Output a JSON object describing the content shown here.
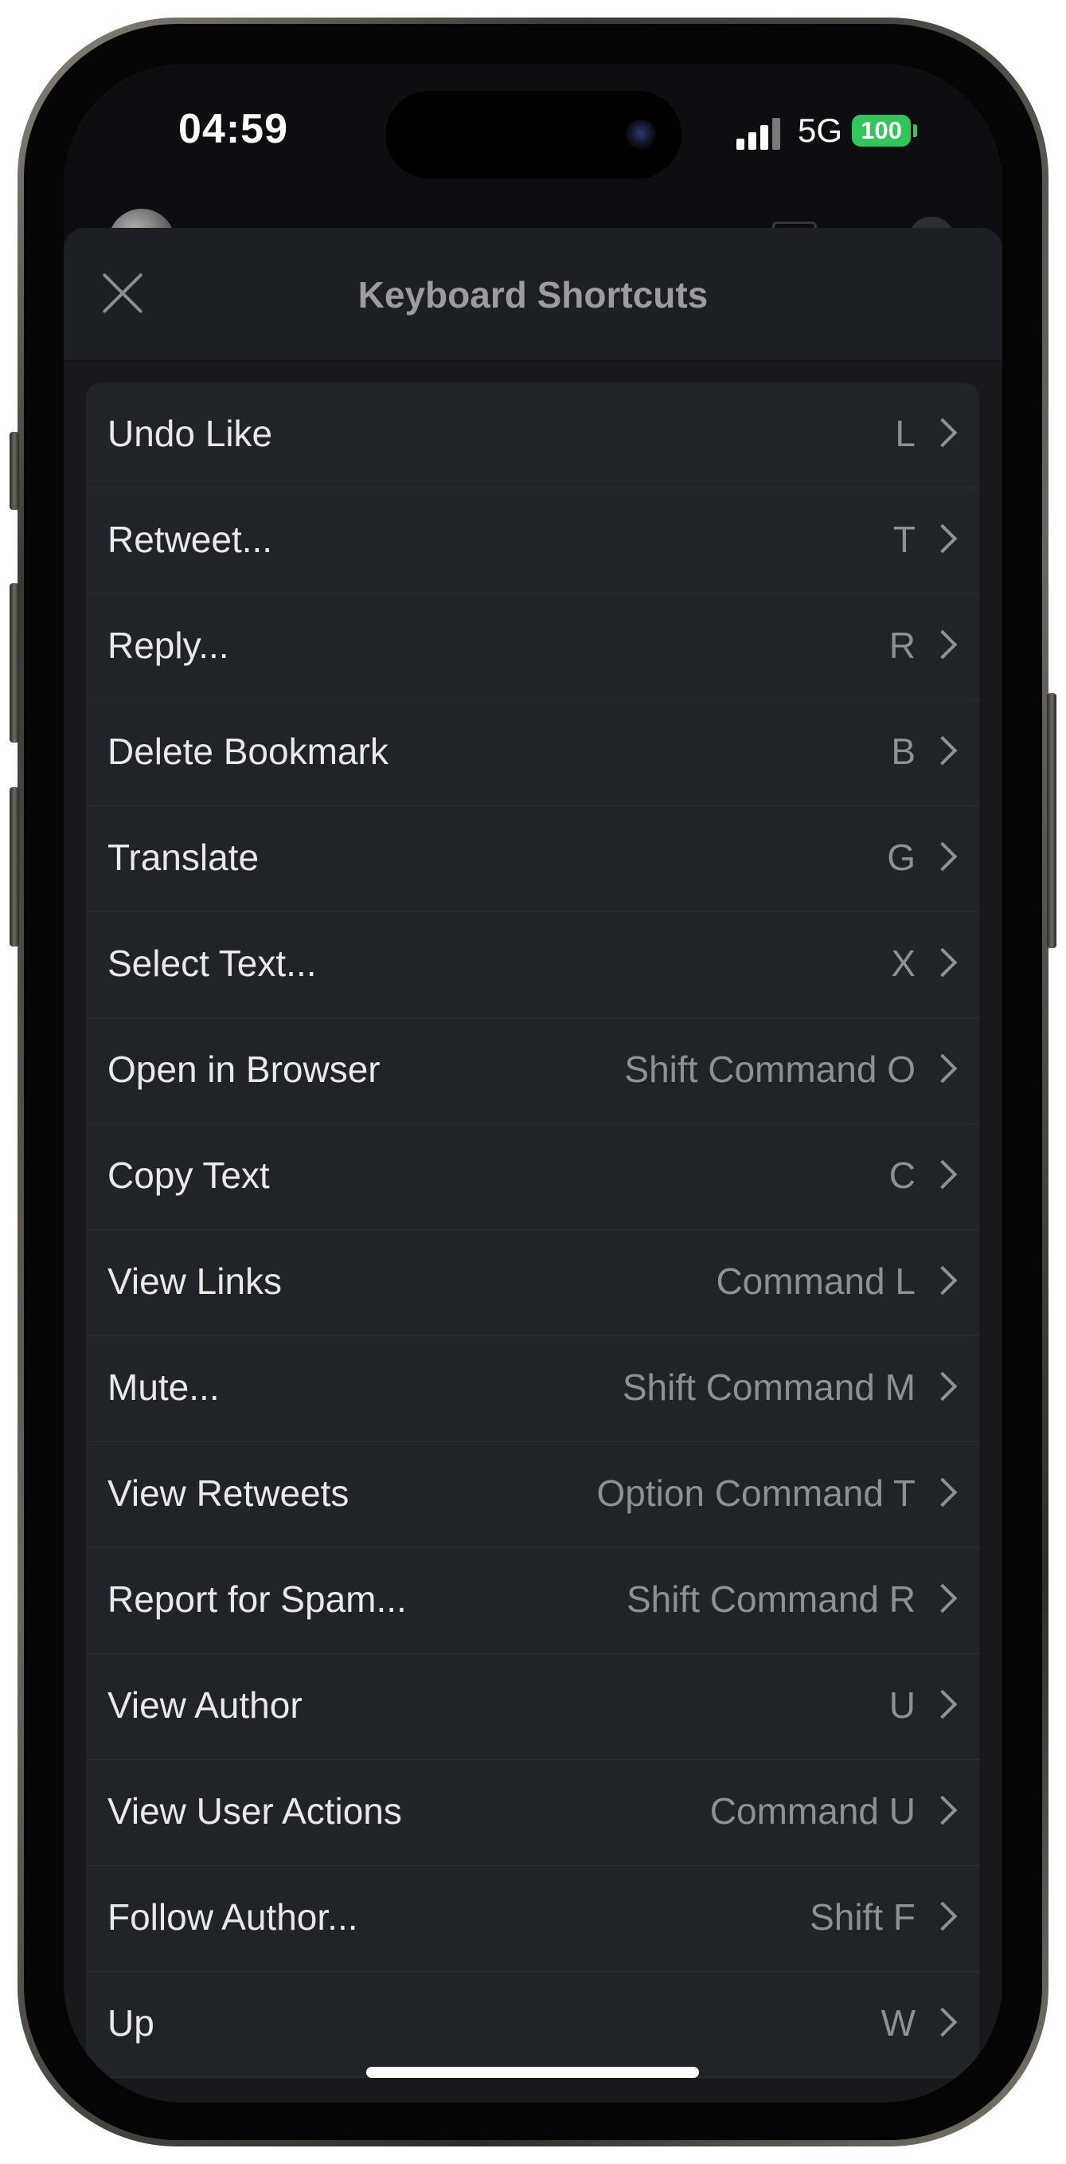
{
  "status_bar": {
    "time": "04:59",
    "network": "5G",
    "battery": "100"
  },
  "sheet": {
    "title": "Keyboard Shortcuts",
    "close_icon": "close-icon"
  },
  "shortcuts": [
    {
      "label": "Undo Like",
      "key": "L"
    },
    {
      "label": "Retweet...",
      "key": "T"
    },
    {
      "label": "Reply...",
      "key": "R"
    },
    {
      "label": "Delete Bookmark",
      "key": "B"
    },
    {
      "label": "Translate",
      "key": "G"
    },
    {
      "label": "Select Text...",
      "key": "X"
    },
    {
      "label": "Open in Browser",
      "key": "Shift Command O"
    },
    {
      "label": "Copy Text",
      "key": "C"
    },
    {
      "label": "View Links",
      "key": "Command L"
    },
    {
      "label": "Mute...",
      "key": "Shift Command M"
    },
    {
      "label": "View Retweets",
      "key": "Option Command T"
    },
    {
      "label": "Report for Spam...",
      "key": "Shift Command R"
    },
    {
      "label": "View Author",
      "key": "U"
    },
    {
      "label": "View User Actions",
      "key": "Command U"
    },
    {
      "label": "Follow Author...",
      "key": "Shift F"
    },
    {
      "label": "Up",
      "key": "W"
    }
  ],
  "colors": {
    "battery": "#32c559",
    "sheet_background": "#17191d",
    "row_background": "#202328"
  }
}
